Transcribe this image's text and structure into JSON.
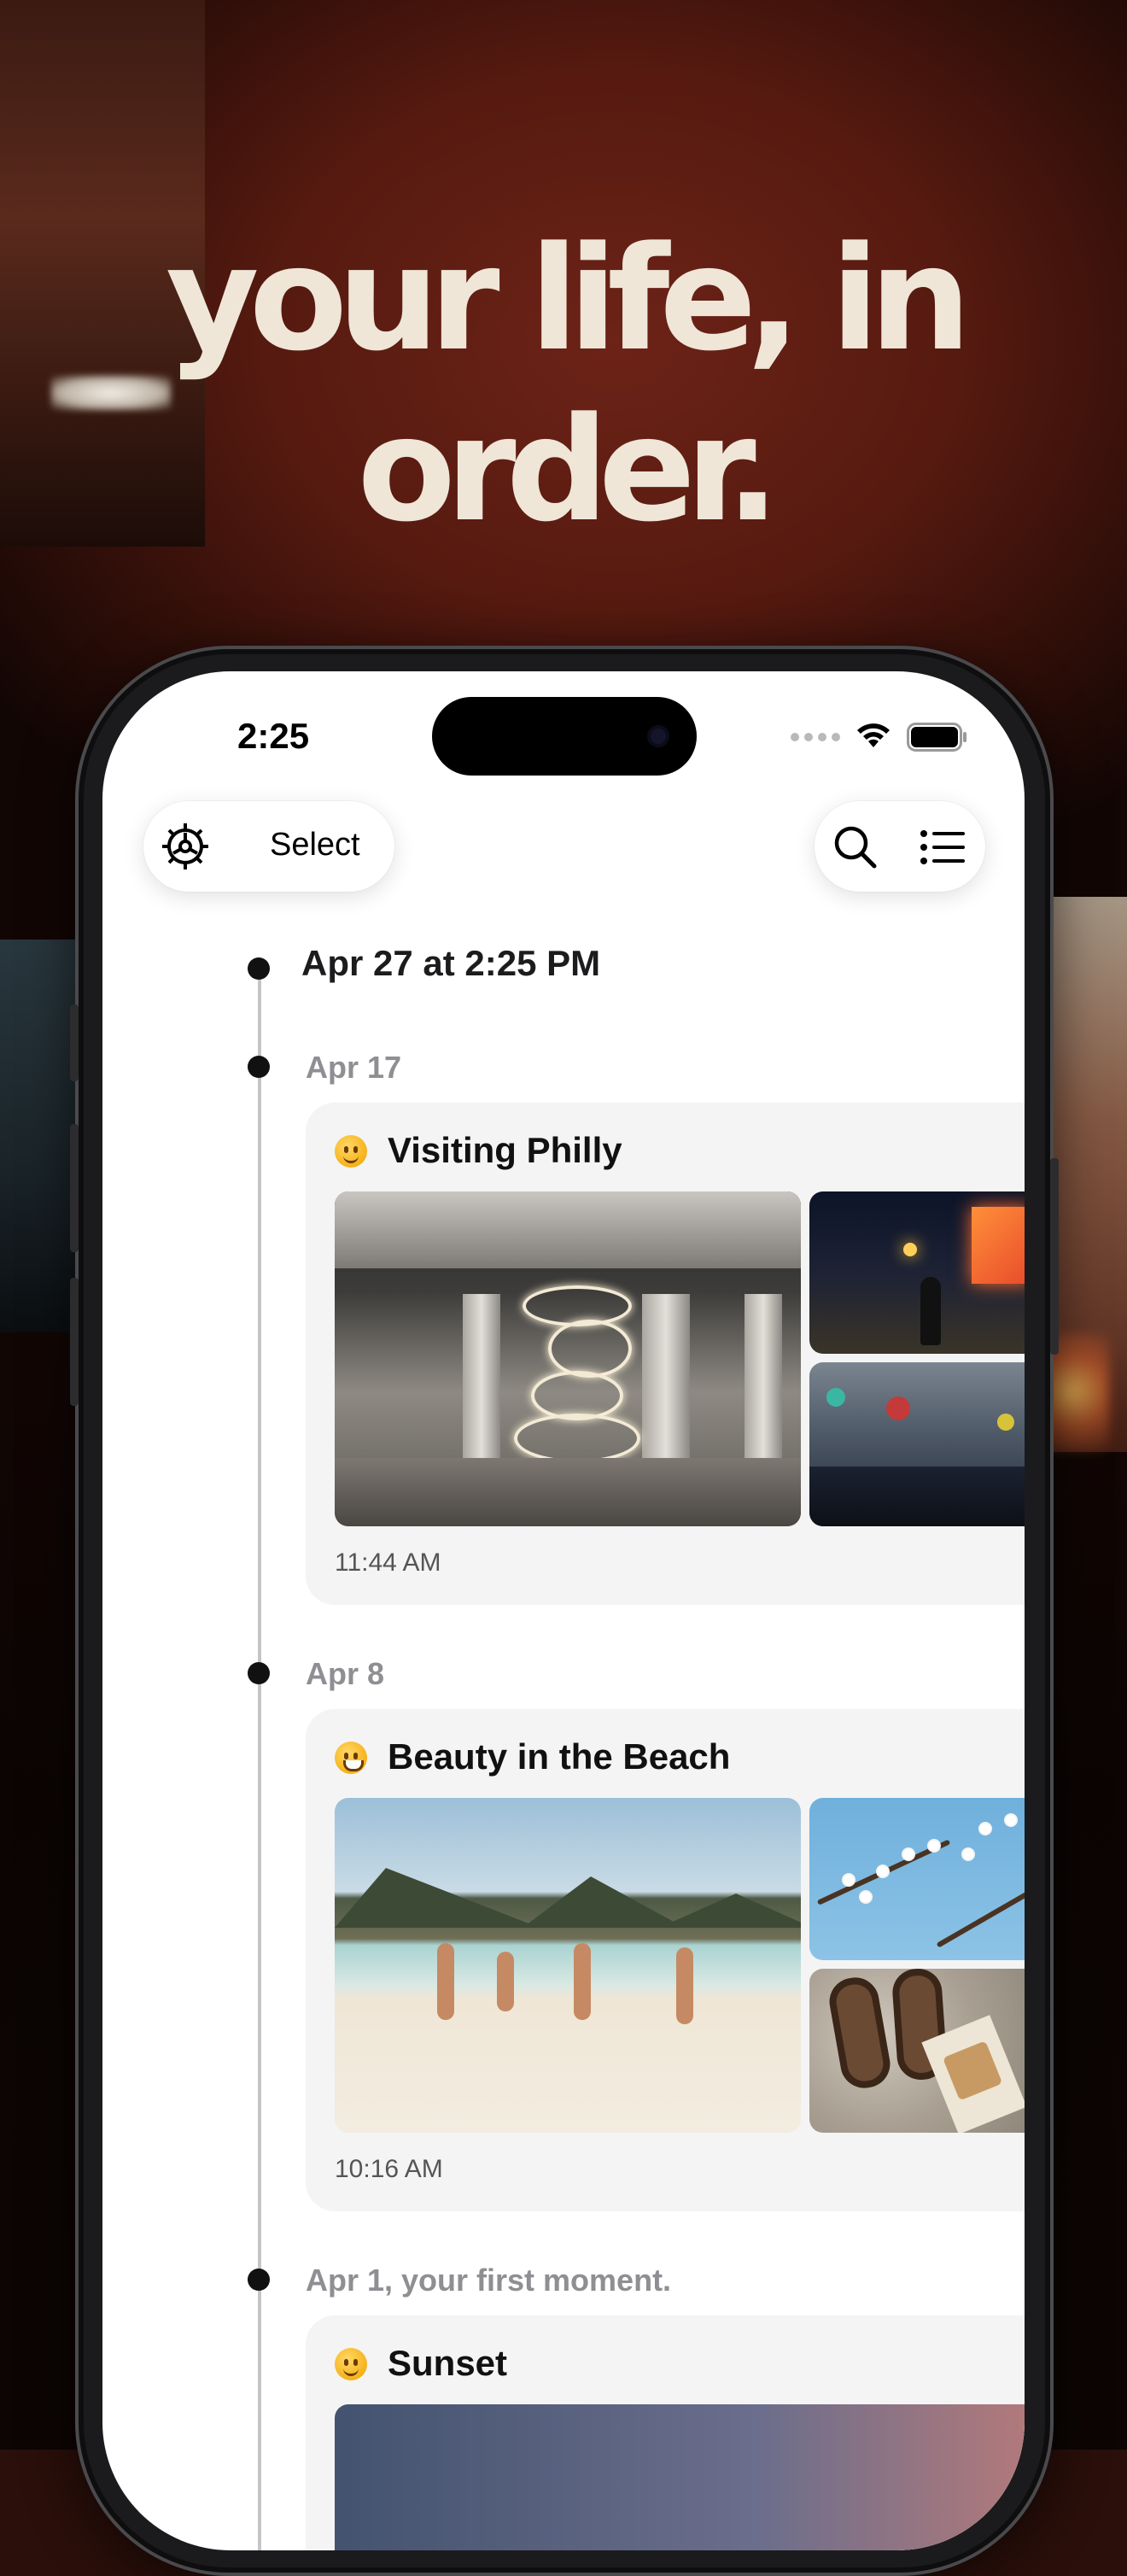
{
  "headline": "your life, in order.",
  "status_bar": {
    "time": "2:25",
    "icons": [
      "cellular-dots-icon",
      "wifi-icon",
      "battery-icon"
    ]
  },
  "toolbar": {
    "settings_icon": "settings-icon",
    "select_label": "Select",
    "search_icon": "search-icon",
    "list_icon": "list-icon"
  },
  "timeline": {
    "now_label": "Apr 27 at 2:25 PM",
    "entries": [
      {
        "date": "Apr 17",
        "emoji": "slightly-smiling-face",
        "title": "Visiting Philly",
        "time": "11:44 AM",
        "photos": [
          "interior-chandelier-photo",
          "night-street-photo",
          "party-tent-photo"
        ]
      },
      {
        "date": "Apr 8",
        "emoji": "grinning-face",
        "title": "Beauty in the Beach",
        "time": "10:16 AM",
        "photos": [
          "beach-photo",
          "blossom-branch-photo",
          "sandals-photo"
        ]
      },
      {
        "date": "Apr 1, your first moment.",
        "emoji": "slightly-smiling-face",
        "title": "Sunset",
        "photos": [
          "sunset-photo"
        ]
      }
    ]
  },
  "colors": {
    "headline": "#efe6d8",
    "background": "#561a10",
    "card": "#f4f4f5",
    "date_text": "#8e8e93"
  }
}
